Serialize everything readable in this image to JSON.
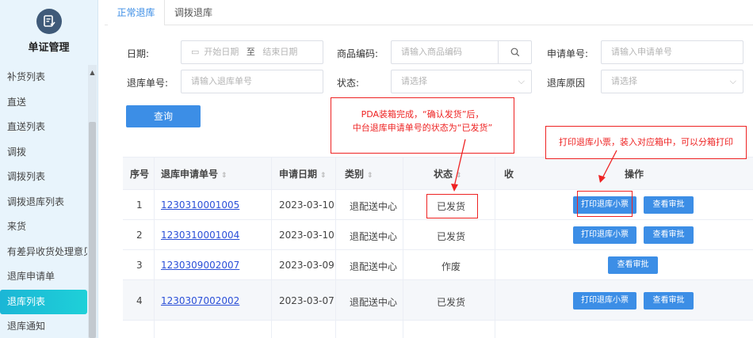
{
  "sidebar": {
    "title": "单证管理",
    "items": [
      {
        "label": "补货列表"
      },
      {
        "label": "直送"
      },
      {
        "label": "直送列表"
      },
      {
        "label": "调拨"
      },
      {
        "label": "调拨列表"
      },
      {
        "label": "调拨退库列表"
      },
      {
        "label": "来货"
      },
      {
        "label": "有差异收货处理意见"
      },
      {
        "label": "退库申请单"
      },
      {
        "label": "退库列表"
      },
      {
        "label": "退库通知"
      }
    ],
    "active_index": 9
  },
  "tabs": [
    {
      "label": "正常退库",
      "active": true
    },
    {
      "label": "调拨退库",
      "active": false
    }
  ],
  "filters": {
    "date_label": "日期:",
    "date_start_placeholder": "开始日期",
    "date_sep": "至",
    "date_end_placeholder": "结束日期",
    "product_code_label": "商品编码:",
    "product_code_placeholder": "请输入商品编码",
    "apply_no_label": "申请单号:",
    "apply_no_placeholder": "请输入申请单号",
    "return_no_label": "退库单号:",
    "return_no_placeholder": "请输入退库单号",
    "status_label": "状态:",
    "status_placeholder": "请选择",
    "reason_label": "退库原因",
    "reason_placeholder": "请选择",
    "query_button": "查询"
  },
  "table": {
    "headers": {
      "index": "序号",
      "apply_no": "退库申请单号",
      "apply_date": "申请日期",
      "category": "类别",
      "status": "状态",
      "receive_partial": "收",
      "actions": "操作"
    },
    "rows": [
      {
        "index": "1",
        "apply_no": "1230310001005",
        "apply_date": "2023-03-10",
        "category": "退配送中心",
        "status": "已发货",
        "print": "打印退库小票",
        "review": "查看审批"
      },
      {
        "index": "2",
        "apply_no": "1230310001004",
        "apply_date": "2023-03-10",
        "category": "退配送中心",
        "status": "已发货",
        "print": "打印退库小票",
        "review": "查看审批"
      },
      {
        "index": "3",
        "apply_no": "1230309002007",
        "apply_date": "2023-03-09",
        "category": "退配送中心",
        "status": "作废",
        "print": "",
        "review": "查看审批"
      },
      {
        "index": "4",
        "apply_no": "1230307002002",
        "apply_date": "2023-03-07",
        "category": "退配送中心",
        "status": "已发货",
        "print": "打印退库小票",
        "review": "查看审批"
      }
    ]
  },
  "annotations": {
    "note1_line1": "PDA装箱完成，“确认发货”后，",
    "note1_line2": "中台退库申请单号的状态为“已发货”",
    "note2": "打印退库小票，装入对应箱中，可以分箱打印"
  },
  "colors": {
    "accent": "#3c8ee6",
    "active_menu": "#1bb6d6",
    "annotation": "#ee2222",
    "link": "#2a4fd8"
  }
}
